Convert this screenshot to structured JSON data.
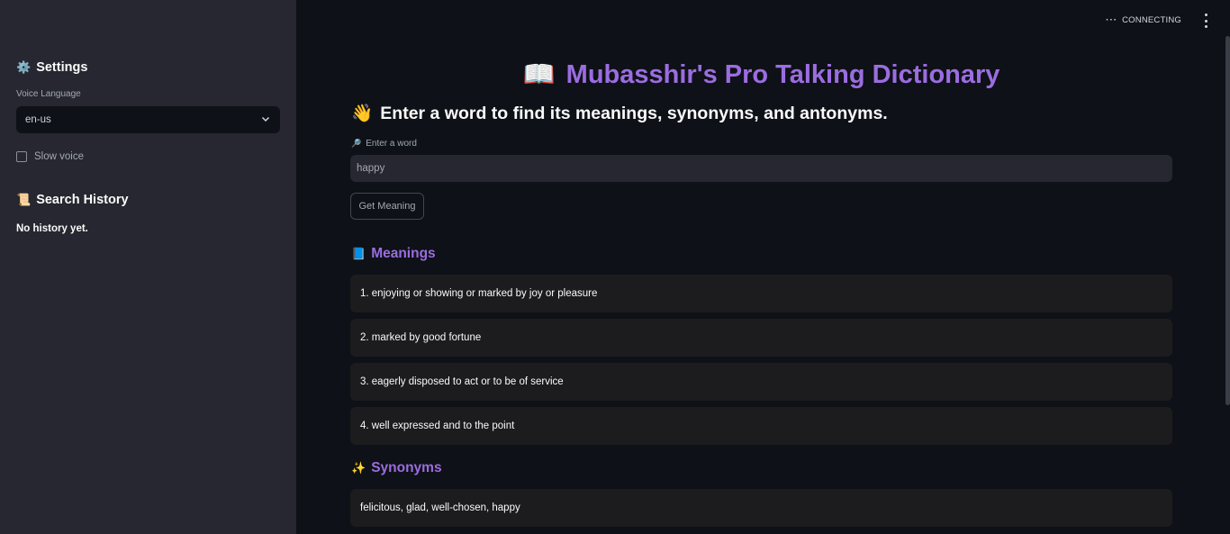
{
  "sidebar": {
    "settings_icon": "⚙️",
    "settings_title": "Settings",
    "voice_language_label": "Voice Language",
    "voice_language_value": "en-us",
    "slow_voice_label": "Slow voice",
    "slow_voice_checked": false,
    "history_icon": "📜",
    "history_title": "Search History",
    "history_empty": "No history yet."
  },
  "header": {
    "status": "CONNECTING"
  },
  "main": {
    "title_icon": "📖",
    "title": "Mubasshir's Pro Talking Dictionary",
    "subtitle_icon": "👋",
    "subtitle": "Enter a word to find its meanings, synonyms, and antonyms.",
    "input_icon": "🔎",
    "input_label": "Enter a word",
    "input_value": "happy",
    "button_label": "Get Meaning",
    "meanings_icon": "📘",
    "meanings_title": "Meanings",
    "meanings": [
      "1. enjoying or showing or marked by joy or pleasure",
      "2. marked by good fortune",
      "3. eagerly disposed to act or to be of service",
      "4. well expressed and to the point"
    ],
    "synonyms_icon": "✨",
    "synonyms_title": "Synonyms",
    "synonyms": "felicitous, glad, well-chosen, happy"
  },
  "colors": {
    "accent": "#9b6de0",
    "background": "#0e1117",
    "sidebar": "#262730"
  }
}
